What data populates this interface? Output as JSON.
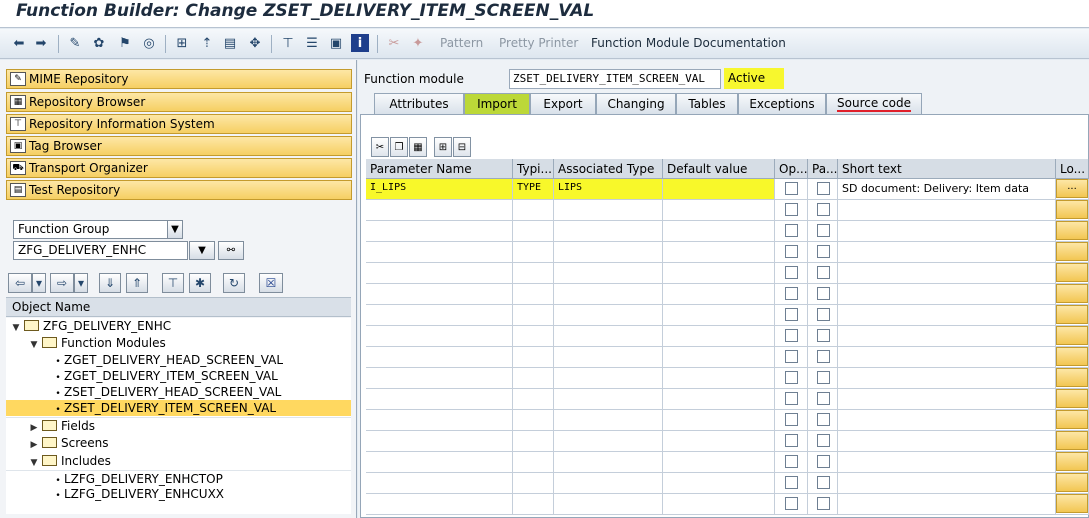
{
  "window": {
    "title": "Function Builder: Change ZSET_DELIVERY_ITEM_SCREEN_VAL"
  },
  "toolbar": {
    "pattern_label": "Pattern",
    "pretty_printer_label": "Pretty Printer",
    "doc_label": "Function Module Documentation"
  },
  "nav": {
    "items": [
      {
        "label": "MIME Repository",
        "icon": "mime-icon"
      },
      {
        "label": "Repository Browser",
        "icon": "browser-icon"
      },
      {
        "label": "Repository Information System",
        "icon": "info-system-icon"
      },
      {
        "label": "Tag Browser",
        "icon": "tag-icon"
      },
      {
        "label": "Transport Organizer",
        "icon": "truck-icon"
      },
      {
        "label": "Test Repository",
        "icon": "test-icon"
      }
    ]
  },
  "browser": {
    "object_type": "Function Group",
    "object_value": "ZFG_DELIVERY_ENHC",
    "tree_header": "Object Name",
    "tree": [
      {
        "label": "ZFG_DELIVERY_ENHC"
      },
      {
        "label": "Function Modules"
      },
      {
        "label": "ZGET_DELIVERY_HEAD_SCREEN_VAL"
      },
      {
        "label": "ZGET_DELIVERY_ITEM_SCREEN_VAL"
      },
      {
        "label": "ZSET_DELIVERY_HEAD_SCREEN_VAL"
      },
      {
        "label": "ZSET_DELIVERY_ITEM_SCREEN_VAL"
      },
      {
        "label": "Fields"
      },
      {
        "label": "Screens"
      },
      {
        "label": "Includes"
      },
      {
        "label": "LZFG_DELIVERY_ENHCTOP"
      },
      {
        "label": "LZFG_DELIVERY_ENHCUXX"
      }
    ]
  },
  "module": {
    "label": "Function module",
    "name": "ZSET_DELIVERY_ITEM_SCREEN_VAL",
    "status": "Active"
  },
  "tabs": [
    "Attributes",
    "Import",
    "Export",
    "Changing",
    "Tables",
    "Exceptions",
    "Source code"
  ],
  "grid": {
    "columns": [
      "Parameter Name",
      "Typi...",
      "Associated Type",
      "Default value",
      "Op...",
      "Pa...",
      "Short text",
      "Lo..."
    ],
    "rows": [
      {
        "name": "I_LIPS",
        "typing": "TYPE",
        "assoc": "LIPS",
        "default": "",
        "short": "SD document: Delivery: Item data",
        "lo": "..."
      }
    ]
  },
  "colors": {
    "accent_yellow": "#f7f72e",
    "nav_button": "#f6cf63",
    "active_tab": "#bcd838",
    "underline_red": "#e0202a"
  }
}
